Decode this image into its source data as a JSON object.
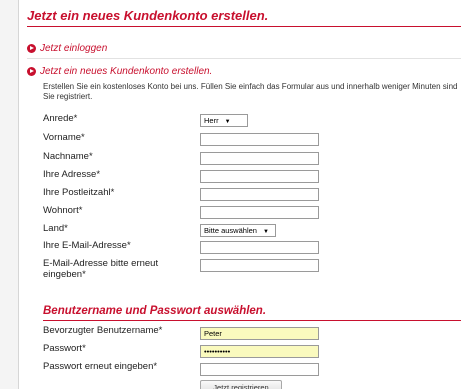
{
  "header": {
    "title": "Jetzt ein neues Kundenkonto erstellen."
  },
  "links": {
    "login": "Jetzt einloggen",
    "create": "Jetzt ein neues Kundenkonto erstellen."
  },
  "intro": "Erstellen Sie ein kostenloses Konto bei uns. Füllen Sie einfach das Formular aus und innerhalb weniger Minuten sind Sie registriert.",
  "form": {
    "salutation": {
      "label": "Anrede*",
      "value": "Herr"
    },
    "firstname": {
      "label": "Vorname*",
      "value": ""
    },
    "lastname": {
      "label": "Nachname*",
      "value": ""
    },
    "address": {
      "label": "Ihre Adresse*",
      "value": ""
    },
    "zip": {
      "label": "Ihre Postleitzahl*",
      "value": ""
    },
    "city": {
      "label": "Wohnort*",
      "value": ""
    },
    "country": {
      "label": "Land*",
      "value": "Bitte auswählen"
    },
    "email": {
      "label": "Ihre E-Mail-Adresse*",
      "value": ""
    },
    "email_repeat": {
      "label": "E-Mail-Adresse bitte erneut eingeben*",
      "value": ""
    }
  },
  "account": {
    "title": "Benutzername und Passwort auswählen.",
    "username": {
      "label": "Bevorzugter Benutzername*",
      "value": "Peter"
    },
    "password": {
      "label": "Passwort*",
      "value": "••••••••••"
    },
    "password_repeat": {
      "label": "Passwort erneut eingeben*",
      "value": ""
    },
    "submit_label": "Jetzt registrieren"
  },
  "colors": {
    "accent": "#c8102e",
    "autofill": "#fafabe"
  }
}
